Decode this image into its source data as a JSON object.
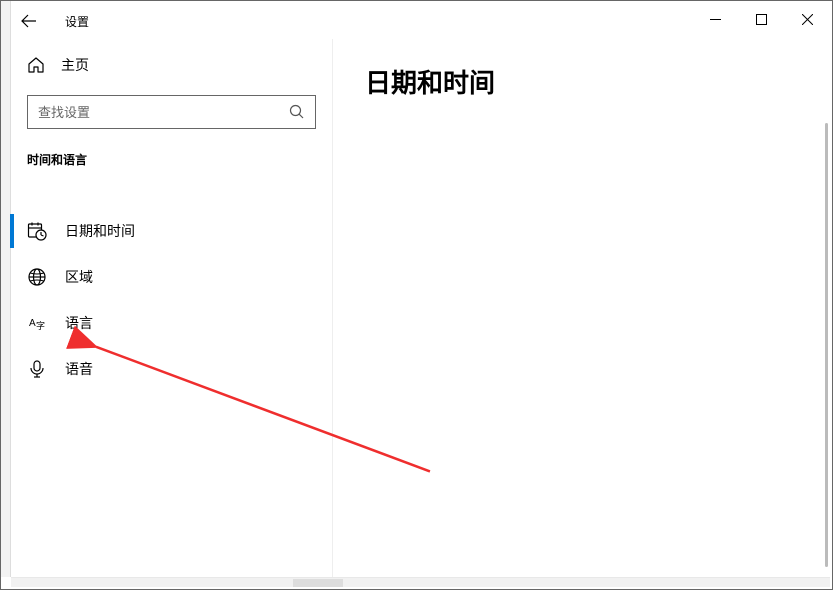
{
  "window": {
    "title": "设置"
  },
  "sidebar": {
    "home_label": "主页",
    "search_placeholder": "查找设置",
    "category_header": "时间和语言",
    "items": [
      {
        "label": "日期和时间",
        "active": true
      },
      {
        "label": "区域",
        "active": false
      },
      {
        "label": "语言",
        "active": false
      },
      {
        "label": "语音",
        "active": false
      }
    ]
  },
  "content": {
    "page_title": "日期和时间"
  }
}
